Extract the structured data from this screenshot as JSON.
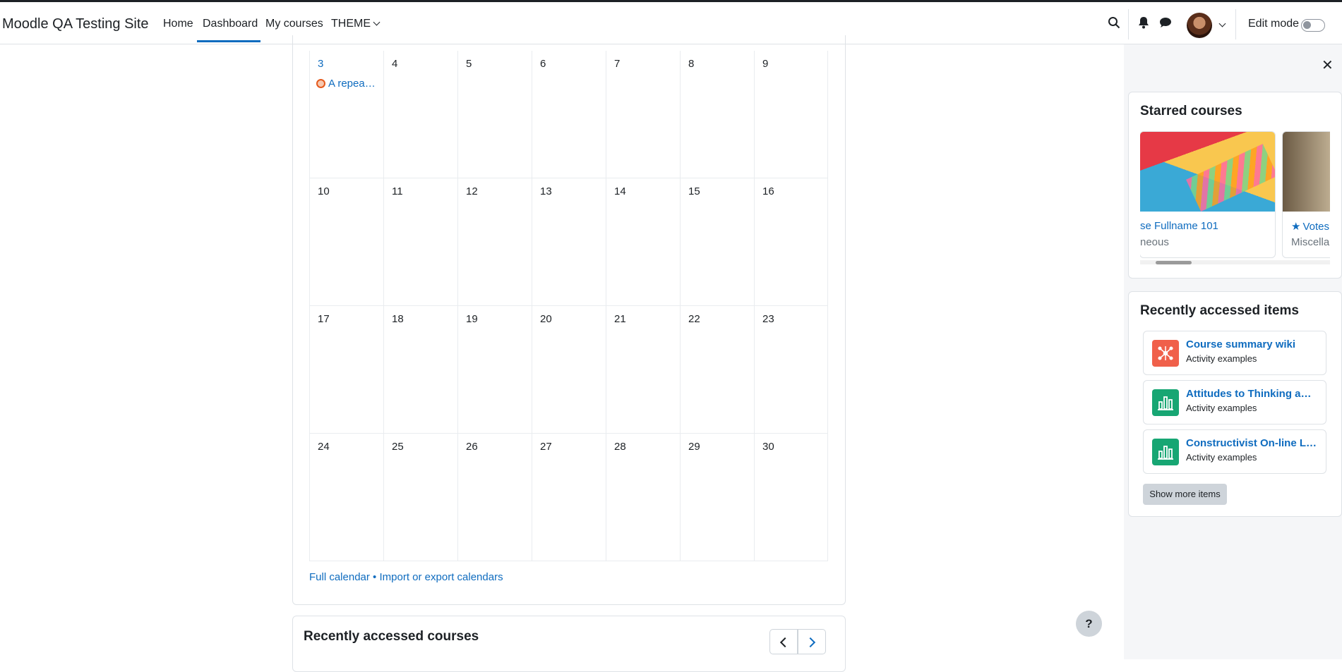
{
  "navbar": {
    "site_name": "Moodle QA Testing Site",
    "links": [
      "Home",
      "Dashboard",
      "My courses",
      "THEME"
    ],
    "edit_mode_label": "Edit mode"
  },
  "calendar": {
    "weeks": [
      [
        "3",
        "4",
        "5",
        "6",
        "7",
        "8",
        "9"
      ],
      [
        "10",
        "11",
        "12",
        "13",
        "14",
        "15",
        "16"
      ],
      [
        "17",
        "18",
        "19",
        "20",
        "21",
        "22",
        "23"
      ],
      [
        "24",
        "25",
        "26",
        "27",
        "28",
        "29",
        "30"
      ]
    ],
    "event_label": "A repea…",
    "footer_full": "Full calendar",
    "footer_sep": " • ",
    "footer_import": "Import or export calendars"
  },
  "recent_courses": {
    "title": "Recently accessed courses"
  },
  "drawer": {
    "starred_title": "Starred courses",
    "starred": [
      {
        "name": "se Fullname 101",
        "category": "neous"
      },
      {
        "name": "Votes",
        "category": "Miscella"
      }
    ],
    "recent_title": "Recently accessed items",
    "recent_items": [
      {
        "name": "Course summary wiki",
        "sub": "Activity examples"
      },
      {
        "name": "Attitudes to Thinking a…",
        "sub": "Activity examples"
      },
      {
        "name": "Constructivist On-line L…",
        "sub": "Activity examples"
      }
    ],
    "show_more": "Show more items"
  },
  "help_label": "?",
  "close_label": "✕"
}
